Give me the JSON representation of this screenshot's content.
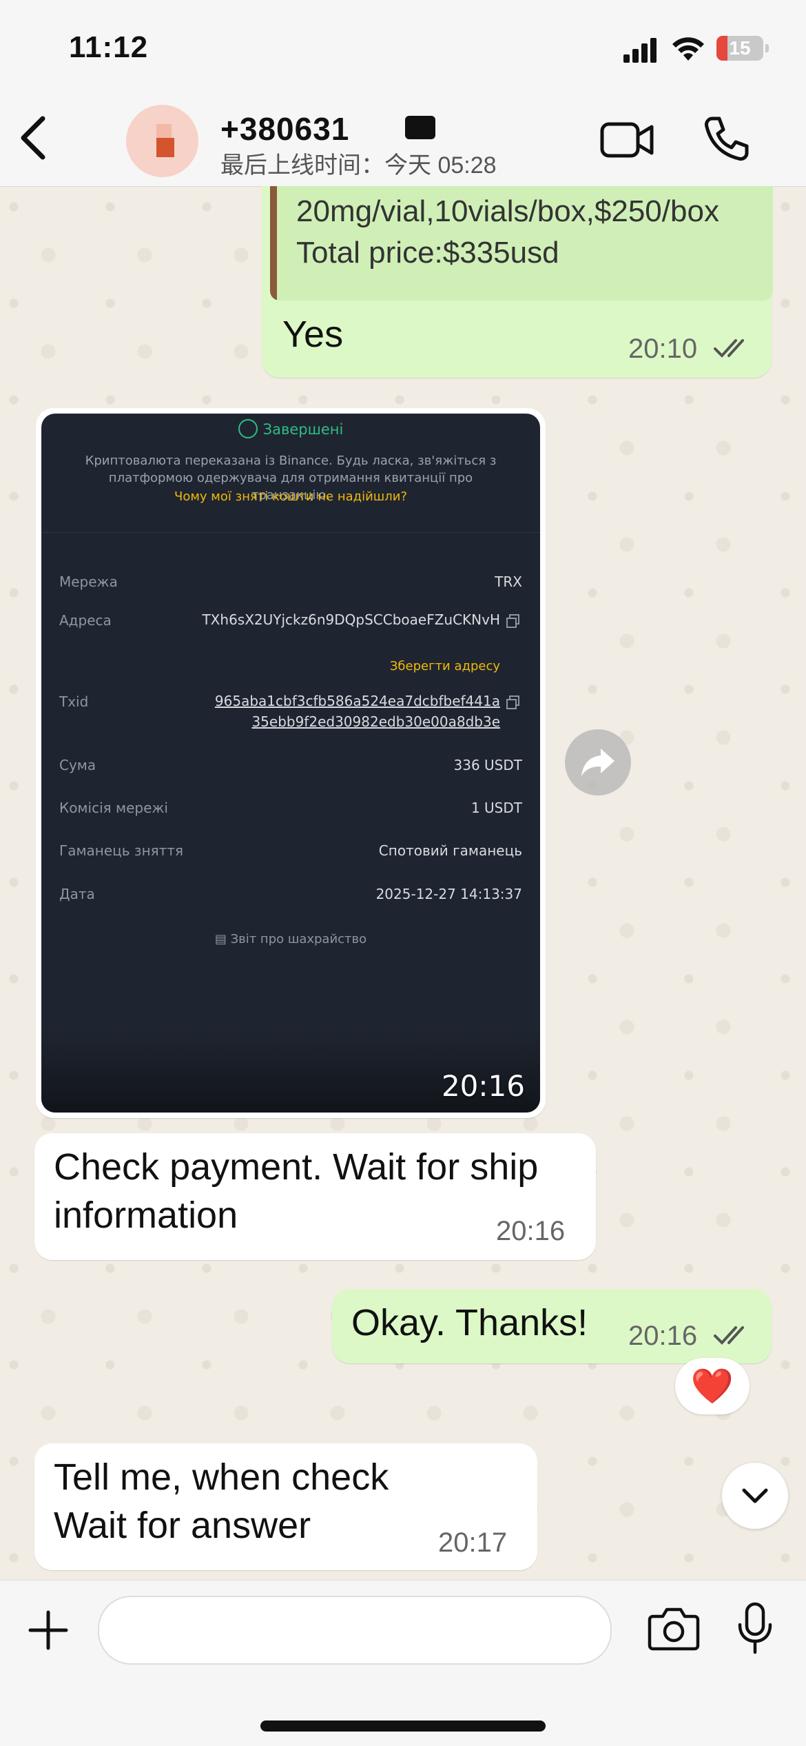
{
  "status_bar": {
    "time": "11:12",
    "battery": "15"
  },
  "header": {
    "contact_name": "+380631",
    "last_seen": "最后上线时间：今天 05:28",
    "back_icon": "chevron-left-icon",
    "video_icon": "video-camera-icon",
    "call_icon": "phone-icon"
  },
  "messages": {
    "m1": {
      "quote_line1": "20mg/vial,10vials/box,$250/box",
      "quote_line2": "Total price:$335usd",
      "text": "Yes",
      "time": "20:10"
    },
    "image": {
      "status": "Завершені",
      "description": "Криптовалюта переказана із Binance. Будь ласка, зв'яжіться з платформою одержувача для отримання квитанції про транзакцію.",
      "link": "Чому мої зняті кошти не надійшли?",
      "rows": {
        "network_label": "Мережа",
        "network_value": "TRX",
        "address_label": "Адреса",
        "address_value": "TXh6sX2UYjckz6n9DQpSCCboaeFZuCKNvH",
        "save_address": "Зберегти адресу",
        "txid_label": "Txid",
        "txid_value": "965aba1cbf3cfb586a524ea7dcbfbef441a35ebb9f2ed30982edb30e00a8db3e",
        "amount_label": "Сума",
        "amount_value": "336 USDT",
        "fee_label": "Комісія мережі",
        "fee_value": "1 USDT",
        "wallet_label": "Гаманець зняття",
        "wallet_value": "Спотовий гаманець",
        "date_label": "Дата",
        "date_value": "2025-12-27 14:13:37"
      },
      "report": "Звіт про шахрайство",
      "time": "20:16"
    },
    "m2": {
      "text_line1": "Check payment. Wait for ship",
      "text_line2": "information",
      "time": "20:16"
    },
    "m3": {
      "text": "Okay. Thanks!",
      "time": "20:16",
      "reaction": "❤️"
    },
    "m4": {
      "text_line1": "Tell me, when check",
      "text_line2": "Wait for answer",
      "time": "20:17"
    }
  },
  "input": {
    "placeholder": "",
    "plus_icon": "plus-icon",
    "sticker_icon": "sticker-icon",
    "camera_icon": "camera-icon",
    "mic_icon": "microphone-icon"
  },
  "colors": {
    "outgoing_bubble": "#dcf8c6",
    "incoming_bubble": "#ffffff",
    "binance_bg": "#1f2530",
    "binance_accent": "#f0b90b",
    "success_green": "#2ebd85"
  }
}
